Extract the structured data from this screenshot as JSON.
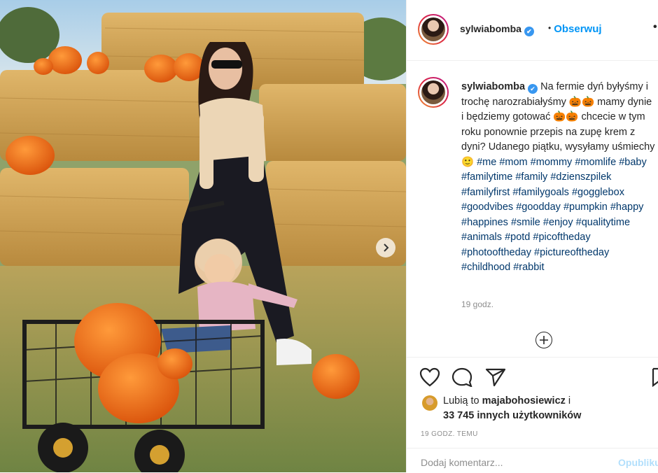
{
  "post": {
    "username": "sylwiabomba",
    "verified_mark": "✔",
    "follow_label": "Obserwuj",
    "follow_sep": "•",
    "more_label": "•",
    "caption": {
      "text_lines": [
        "Na fermie dyń",
        "byłyśmy i trochę narozrabiałyśmy 🎃🎃",
        "mamy dynie i będziemy gotować 🎃🎃",
        "chcecie w tym roku ponownie przepis",
        "na zupę krem z dyni? Udanego piątku,",
        "wysyłamy uśmiechy 🙂"
      ],
      "hashtags": [
        "#me",
        "#mom",
        "#mommy",
        "#momlife",
        "#baby",
        "#familytime",
        "#family",
        "#dzienszpilek",
        "#familyfirst",
        "#familygoals",
        "#gogglebox",
        "#goodvibes",
        "#goodday",
        "#pumpkin",
        "#happy",
        "#happines",
        "#smile",
        "#enjoy",
        "#qualitytime",
        "#animals",
        "#potd",
        "#picoftheday",
        "#photooftheday",
        "#pictureoftheday",
        "#childhood",
        "#rabbit"
      ]
    },
    "time_relative": "19 godz.",
    "load_more_icon": "plus-circle-icon",
    "likes": {
      "prefix": "Lubią to ",
      "user": "majabohosiewicz",
      "suffix": " i",
      "count_text": "33 745 innych użytkowników"
    },
    "date": "19 GODZ. TEMU",
    "comment_placeholder": "Dodaj komentarz...",
    "post_button": "Opublikuj"
  },
  "photo": {
    "carousel_next_icon": "chevron-right-icon"
  },
  "colors": {
    "accent": "#0095f6",
    "hashtag": "#00376b",
    "muted": "#8e8e8e",
    "border": "#efefef"
  }
}
